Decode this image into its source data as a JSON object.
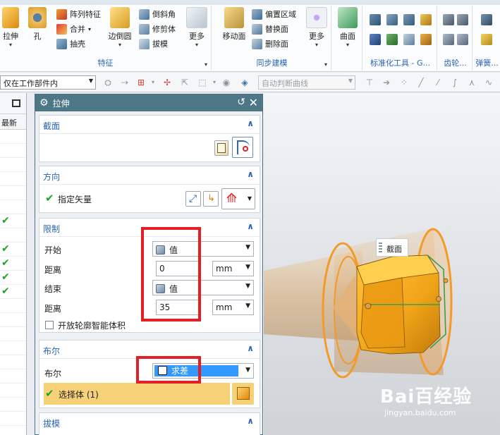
{
  "ribbon": {
    "feature_group": {
      "title": "特征",
      "extrude": "拉伸",
      "hole": "孔",
      "pattern_feature": "阵列特征",
      "unite": "合并",
      "shell": "抽壳",
      "edge_blend": "边倒圆",
      "chamfer": "倒斜角",
      "trim_body": "修剪体",
      "draft": "拔模",
      "more": "更多"
    },
    "sync_group": {
      "title": "同步建模",
      "move_face": "移动面",
      "offset_region": "偏置区域",
      "replace_face": "替换面",
      "delete_face": "删除面",
      "more": "更多"
    },
    "surface_group": {
      "surface": "曲面"
    },
    "std_tools_group": {
      "title": "标准化工具 - G..."
    },
    "gear_group": {
      "title": "齿轮..."
    },
    "spring_group": {
      "title": "弹簧..."
    }
  },
  "toolbar": {
    "filter_select": "仅在工作部件内",
    "curve_rule_select": "自动判断曲线"
  },
  "navigator": {
    "column_latest": "最新",
    "rows": [
      false,
      false,
      false,
      false,
      false,
      false,
      true,
      false,
      true,
      true,
      true,
      true,
      false,
      false,
      false,
      false,
      false,
      false,
      false,
      false,
      false,
      false
    ]
  },
  "dialog": {
    "title": "拉伸",
    "section": {
      "title": "截面"
    },
    "direction": {
      "title": "方向",
      "specify_vector": "指定矢量"
    },
    "limits": {
      "title": "限制",
      "start_label": "开始",
      "start_value": "值",
      "distance1_label": "距离",
      "distance1_value": "0",
      "distance1_unit": "mm",
      "end_label": "结束",
      "end_value": "值",
      "distance2_label": "距离",
      "distance2_value": "35",
      "distance2_unit": "mm",
      "open_profile": "开放轮廓智能体积"
    },
    "boolean": {
      "title": "布尔",
      "label": "布尔",
      "value": "求差",
      "select_body": "选择体 (1)"
    },
    "draft": {
      "title": "拔模"
    }
  },
  "viewport": {
    "section_tag": "截面",
    "watermark_main": "Bai百经验",
    "watermark_sub": "jingyan.baidu.com"
  }
}
